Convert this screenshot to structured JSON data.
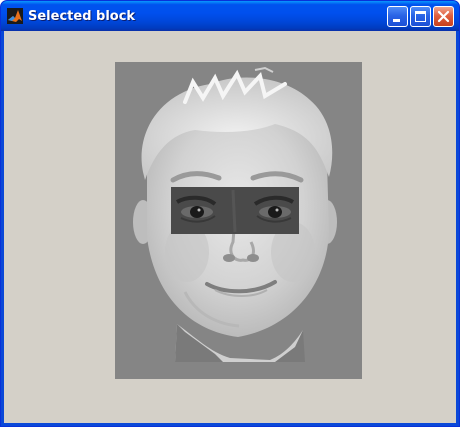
{
  "window": {
    "title": "Selected block",
    "app_icon": "matlab-icon",
    "controls": [
      "minimize-icon",
      "maximize-icon",
      "close-icon"
    ]
  },
  "figure": {
    "background_color": "#d4d0c8",
    "image_background_color": "#858585",
    "content": "grayscale-face",
    "highlighted_region": "eyes-block"
  }
}
